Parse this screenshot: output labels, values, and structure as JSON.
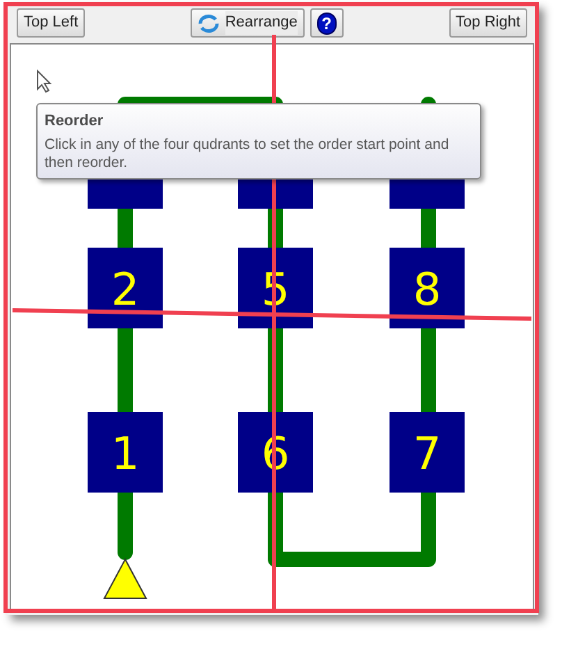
{
  "toolbar": {
    "buttons": [
      {
        "kind": "text",
        "label": "Top Left"
      },
      {
        "kind": "icon-text",
        "label": "Rearrange"
      },
      {
        "kind": "help",
        "label": "?"
      },
      {
        "kind": "text",
        "label": "Top Right"
      }
    ]
  },
  "tooltip": {
    "title": "Reorder",
    "text": "Click in any of the four qudrants to set the order start point and then reorder."
  },
  "tiles": [
    {
      "label": "2"
    },
    {
      "label": "5"
    },
    {
      "label": "8"
    },
    {
      "label": "1"
    },
    {
      "label": "6"
    },
    {
      "label": "7"
    }
  ]
}
